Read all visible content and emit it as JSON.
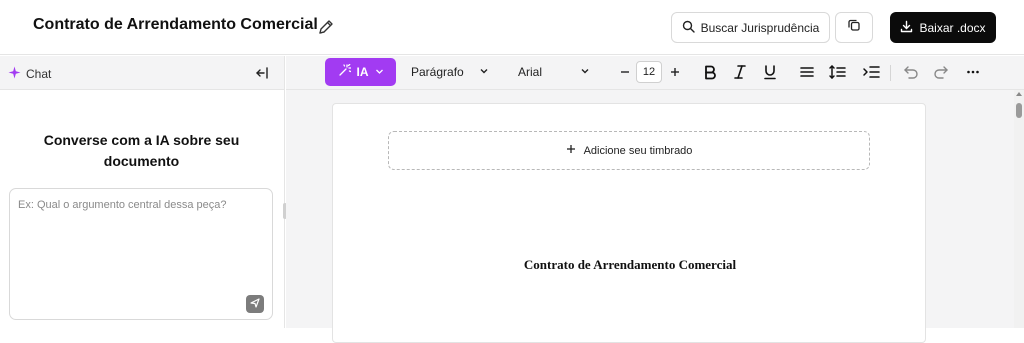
{
  "header": {
    "title": "Contrato de Arrendamento Comercial",
    "search_button_label": "Buscar Jurisprudência",
    "download_button_label": "Baixar .docx"
  },
  "chat": {
    "tab_label": "Chat",
    "heading": "Converse com a IA sobre seu documento",
    "input_placeholder": "Ex: Qual o argumento central dessa peça?"
  },
  "toolbar": {
    "ia_label": "IA",
    "paragraph_style": "Parágrafo",
    "font_family": "Arial",
    "font_size": "12"
  },
  "document": {
    "letterhead_label": "Adicione seu timbrado",
    "title": "Contrato de Arrendamento Comercial"
  },
  "colors": {
    "ia_accent": "#a23bf2",
    "download_button_bg": "#0b0b0b",
    "chat_sparkle": "#a23bf2"
  },
  "icons": [
    "edit-icon",
    "search-icon",
    "copy-icon",
    "download-icon",
    "sparkle-icon",
    "collapse-left-icon",
    "magic-wand-icon",
    "chevron-down-icon",
    "minus-icon",
    "plus-icon",
    "bold-icon",
    "italic-icon",
    "underline-icon",
    "align-icon",
    "line-spacing-icon",
    "indent-icon",
    "undo-icon",
    "redo-icon",
    "more-icon",
    "send-icon"
  ]
}
